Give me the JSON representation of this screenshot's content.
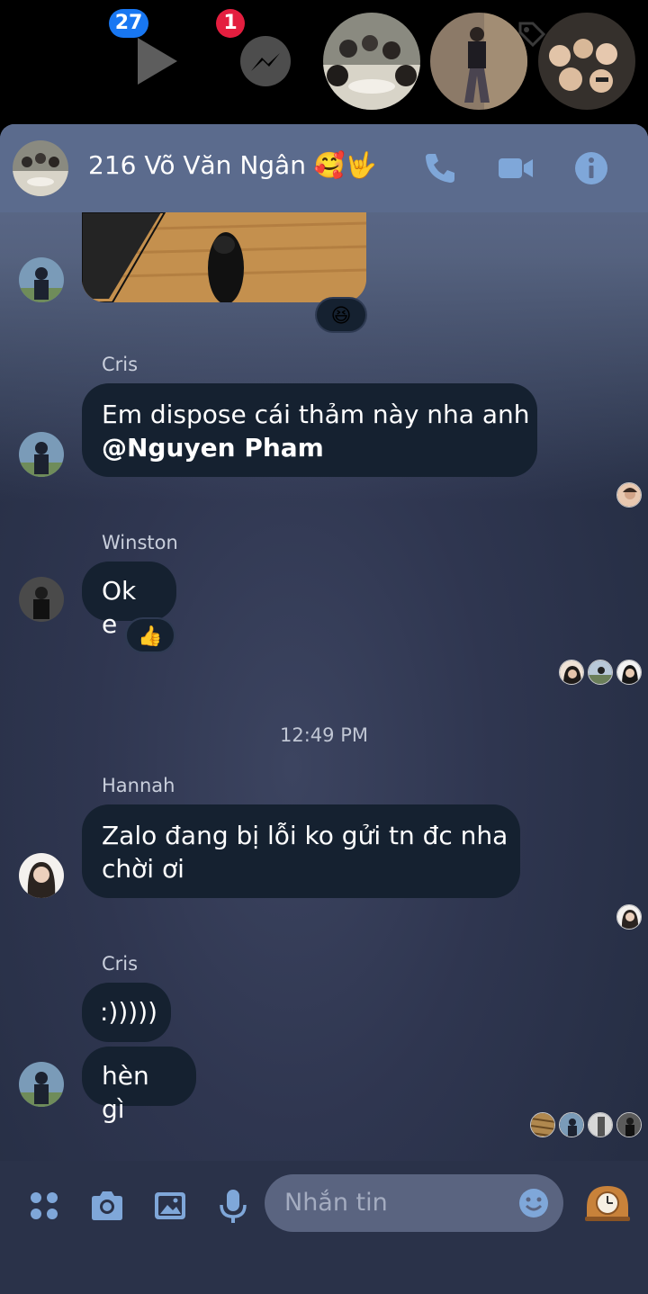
{
  "chat_heads": {
    "video_badge": "27",
    "messenger_badge": "1"
  },
  "header": {
    "title": "216 Võ Văn Ngân 🥰🤟"
  },
  "messages": {
    "reaction_1": "😆",
    "cris_1_sender": "Cris",
    "cris_1_text": "Em dispose cái thảm này nha anh",
    "cris_1_mention": "@Nguyen Pham",
    "winston_sender": "Winston",
    "winston_text": "Ok e",
    "reaction_2": "👍",
    "timestamp": "12:49 PM",
    "hannah_sender": "Hannah",
    "hannah_text_line1": "Zalo đang bị lỗi ko gửi tn đc nha",
    "hannah_text_line2": "chời ơi",
    "cris_2_sender": "Cris",
    "cris_2_text_1": ":)))))",
    "cris_2_text_2": "hèn gì"
  },
  "composer": {
    "placeholder": "Nhắn tin"
  },
  "colors": {
    "accent": "#7fa7d9",
    "badge_blue": "#1877f2",
    "badge_red": "#e41e3f",
    "bubble": "#152130",
    "header": "#5b6b8d"
  }
}
